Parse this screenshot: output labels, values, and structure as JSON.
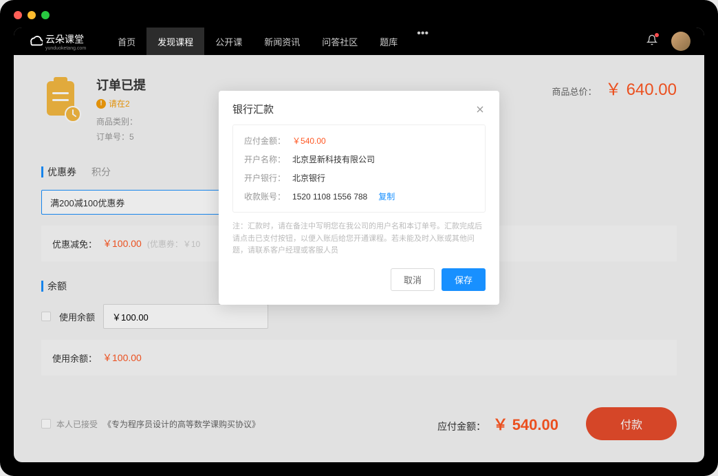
{
  "nav": {
    "logo_text": "云朵课堂",
    "logo_sub": "yunduoketang.com",
    "items": [
      "首页",
      "发现课程",
      "公开课",
      "新闻资讯",
      "问答社区",
      "题库"
    ],
    "active_index": 1
  },
  "order": {
    "title": "订单已提",
    "warning": "请在2",
    "meta_category": "商品类别：",
    "meta_orderno": "订单号：5",
    "total_label": "商品总价：",
    "total_amount": "￥ 640.00"
  },
  "coupon": {
    "title": "优惠券",
    "tab": "积分",
    "selected": "满200减100优惠券",
    "discount_label": "优惠减免：",
    "discount_amount": "￥100.00",
    "discount_note": "(优惠券：￥10"
  },
  "balance": {
    "title": "余额",
    "use_label": "使用余额",
    "input_value": "￥100.00",
    "used_label": "使用余额：",
    "used_amount": "￥100.00"
  },
  "footer": {
    "agree_prefix": "本人已接受",
    "agree_link": "《专为程序员设计的高等数学课购买协议》",
    "pay_label": "应付金额：",
    "pay_amount": "￥ 540.00",
    "pay_btn": "付款"
  },
  "modal": {
    "title": "银行汇款",
    "rows": {
      "amount_label": "应付金额：",
      "amount_value": "￥540.00",
      "account_name_label": "开户名称：",
      "account_name_value": "北京昱新科技有限公司",
      "bank_label": "开户银行：",
      "bank_value": "北京银行",
      "account_no_label": "收款账号：",
      "account_no_value": "1520 1108 1556 788",
      "copy": "复制"
    },
    "note": "注：汇款时，请在备注中写明您在我公司的用户名和本订单号。汇款完成后请点击已支付按钮，以便入账后给您开通课程。若未能及时入账或其他问题，请联系客户经理或客服人员",
    "cancel": "取消",
    "save": "保存"
  }
}
